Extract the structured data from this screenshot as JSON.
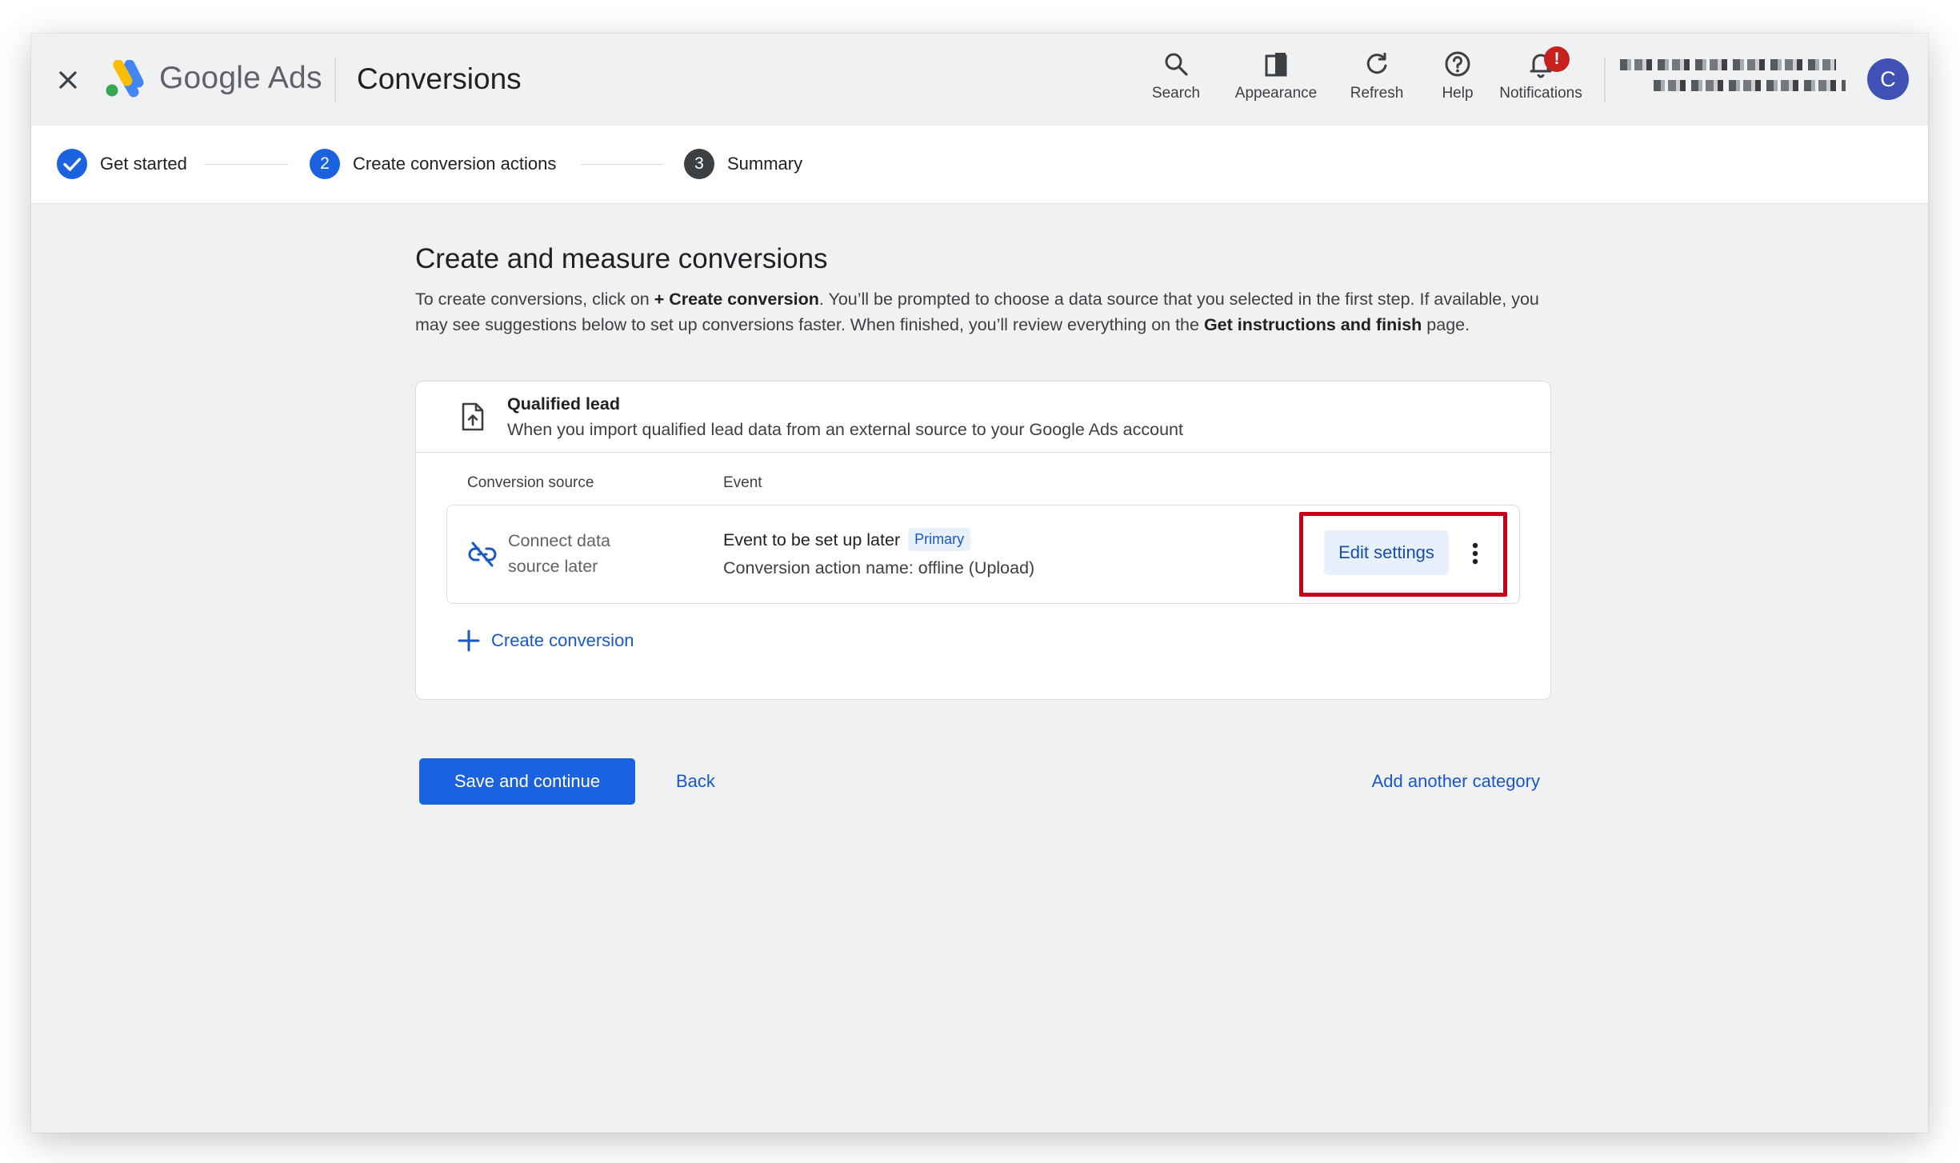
{
  "topbar": {
    "brand": "Google Ads",
    "page_name": "Conversions",
    "tools": {
      "search": "Search",
      "appearance": "Appearance",
      "refresh": "Refresh",
      "help": "Help",
      "notifications": "Notifications"
    },
    "notification_badge": "!",
    "avatar_initial": "C"
  },
  "stepper": {
    "steps": [
      {
        "number": "1",
        "label": "Get started",
        "state": "done"
      },
      {
        "number": "2",
        "label": "Create conversion actions",
        "state": "active"
      },
      {
        "number": "3",
        "label": "Summary",
        "state": "pending"
      }
    ]
  },
  "main": {
    "headline": "Create and measure conversions",
    "description": {
      "part1": "To create conversions, click on ",
      "bold1": "+ Create conversion",
      "part2": ". You’ll be prompted to choose a data source that you selected in the first step. If available, you may see suggestions below to set up conversions faster. When finished, you’ll review everything on the ",
      "bold2": "Get instructions and finish",
      "part3": " page."
    },
    "card": {
      "title": "Qualified lead",
      "subtitle": "When you import qualified lead data from an external source to your Google Ads account",
      "columns": {
        "source": "Conversion source",
        "event": "Event"
      },
      "row": {
        "source_line1": "Connect data",
        "source_line2": "source later",
        "event": "Event to be set up later",
        "badge": "Primary",
        "action_name": "Conversion action name: offline (Upload)",
        "edit_label": "Edit settings"
      },
      "create_label": "Create conversion"
    },
    "actions": {
      "save_label": "Save and continue",
      "back_label": "Back",
      "add_category_label": "Add another category"
    }
  },
  "colors": {
    "accent": "#1a62e0",
    "link": "#1a57c9",
    "highlight": "#c4001a",
    "avatar": "#3f51b5",
    "badge": "#c5221f"
  }
}
